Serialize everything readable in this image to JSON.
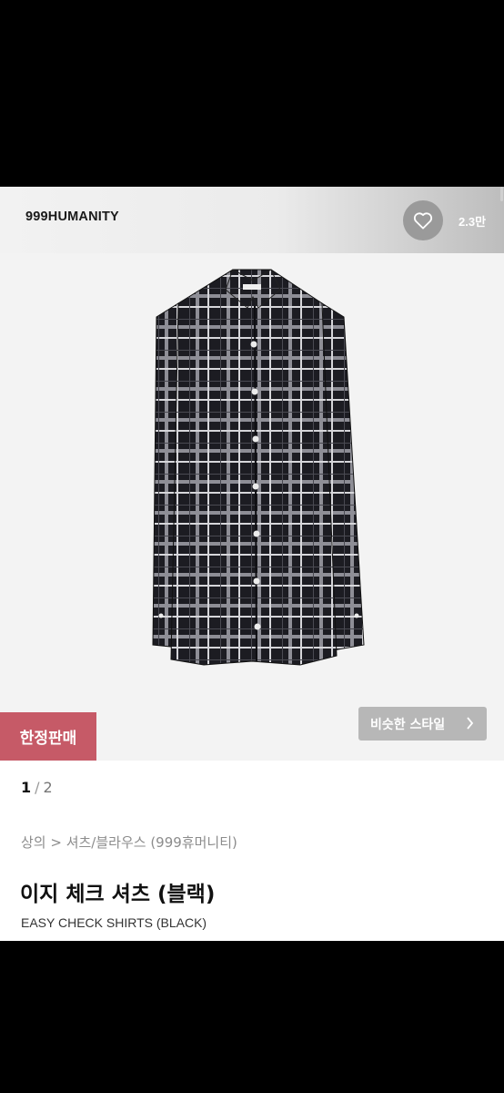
{
  "header": {
    "brand": "999HUMANITY",
    "like_count": "2.3만"
  },
  "icons": {
    "like": "heart-outline-icon",
    "similar": "chevron-right-icon"
  },
  "badge": {
    "label": "한정판매",
    "color": "#c65a67"
  },
  "similar_style": {
    "label": "비슷한 스타일"
  },
  "pager": {
    "current": "1",
    "separator": "/",
    "total": "2"
  },
  "breadcrumb": "상의 > 셔츠/블라우스 (999휴머니티)",
  "product": {
    "title_kr": "이지 체크 셔츠 (블랙)",
    "title_en": "EASY CHECK SHIRTS (BLACK)"
  }
}
